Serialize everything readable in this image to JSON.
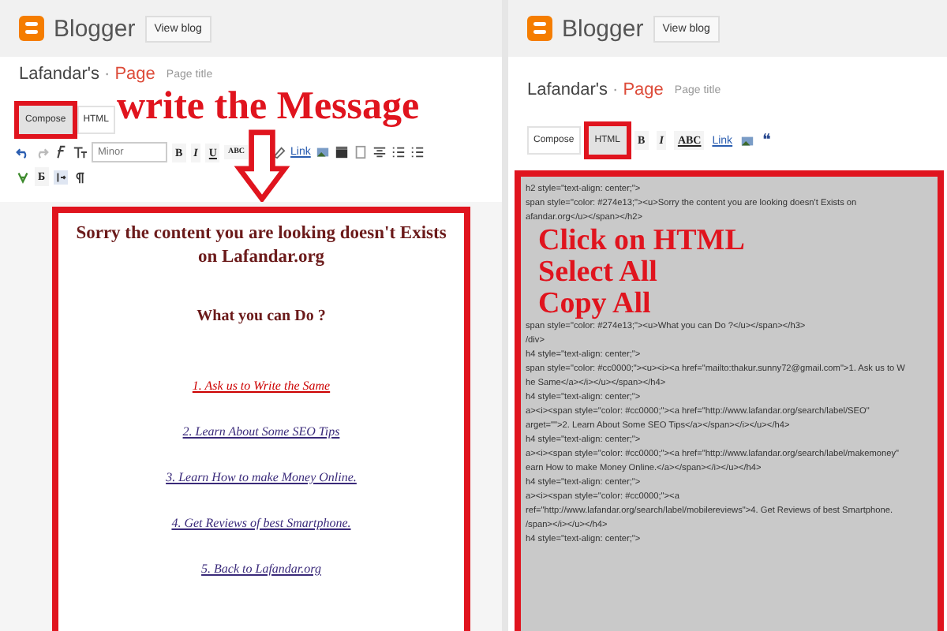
{
  "left_editor": {
    "header": {
      "brand": "Blogger",
      "view_blog": "View blog"
    },
    "blog_name": "Lafandar's",
    "separator": "·",
    "page_label": "Page",
    "title_placeholder": "Page title",
    "mode_tabs": [
      {
        "label": "Compose",
        "selected": true,
        "highlighted": true
      },
      {
        "label": "HTML",
        "selected": false,
        "highlighted": false
      }
    ],
    "font_select": "Minor",
    "format_buttons": [
      "B",
      "I",
      "U",
      "ABC"
    ],
    "link_button": "Link",
    "script_button": "Б",
    "content": {
      "heading": "Sorry the content you are looking doesn't Exists on Lafandar.org",
      "subheading": "What you can Do ?",
      "links": [
        {
          "text": "1. Ask us to Write the Same",
          "color": "#cc0000"
        },
        {
          "text": "2. Learn About Some SEO Tips",
          "color": "#3a2a7a"
        },
        {
          "text": "3. Learn How to make Money Online.",
          "color": "#3a2a7a"
        },
        {
          "text": "4. Get Reviews of best Smartphone.",
          "color": "#3a2a7a"
        },
        {
          "text": "5. Back to Lafandar.org",
          "color": "#3a2a7a"
        }
      ]
    }
  },
  "right_editor": {
    "header": {
      "brand": "Blogger",
      "view_blog": "View blog"
    },
    "blog_name": "Lafandar's",
    "separator": "·",
    "page_label": "Page",
    "title_placeholder": "Page title",
    "mode_tabs": [
      {
        "label": "Compose",
        "selected": false,
        "highlighted": false
      },
      {
        "label": "HTML",
        "selected": true,
        "highlighted": true
      }
    ],
    "format_buttons": [
      "B",
      "I",
      "ABC"
    ],
    "link_button": "Link",
    "quote_button": "❝",
    "code_lines_top": [
      "h2 style=\"text-align: center;\">",
      "span style=\"color: #274e13;\"><u>Sorry the content you are looking doesn't Exists on",
      "afandar.org</u></span></h2>"
    ],
    "code_lines_bottom": [
      "span style=\"color: #274e13;\"><u>What you can Do ?</u></span></h3>",
      "/div>",
      "h4 style=\"text-align: center;\">",
      "span style=\"color: #cc0000;\"><u><i><a href=\"mailto:thakur.sunny72@gmail.com\">1. Ask us to W",
      "he Same</a></i></u></span></h4>",
      "h4 style=\"text-align: center;\">",
      "a><i><span style=\"color: #cc0000;\"><a href=\"http://www.lafandar.org/search/label/SEO\"",
      "arget=\"\">2. Learn About Some SEO Tips</a></span></i></u></h4>",
      "h4 style=\"text-align: center;\">",
      "a><i><span style=\"color: #cc0000;\"><a href=\"http://www.lafandar.org/search/label/makemoney\"",
      "earn How to make Money Online.</a></span></i></u></h4>",
      "h4 style=\"text-align: center;\">",
      "a><i><span style=\"color: #cc0000;\"><a",
      "ref=\"http://www.lafandar.org/search/label/mobilereviews\">4. Get Reviews of best Smartphone.",
      "/span></i></u></h4>",
      "h4 style=\"text-align: center;\">"
    ]
  },
  "annotations": {
    "left_note": "write the Message",
    "right_steps": [
      "Click on HTML",
      "Select All",
      "Copy All"
    ]
  }
}
